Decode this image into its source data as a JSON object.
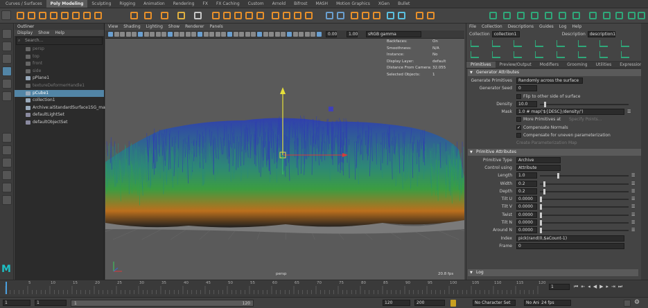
{
  "shelf_tabs": [
    "Curves / Surfaces",
    "Poly Modeling",
    "Sculpting",
    "Rigging",
    "Animation",
    "Rendering",
    "FX",
    "FX Caching",
    "Custom",
    "Arnold",
    "Bifrost",
    "MASH",
    "Motion Graphics",
    "XGen",
    "Bullet"
  ],
  "shelf_active": "Poly Modeling",
  "outliner": {
    "title": "Outliner",
    "menus": [
      "Display",
      "Show",
      "Help"
    ],
    "search_placeholder": "Search...",
    "items": [
      {
        "label": "persp",
        "dim": true
      },
      {
        "label": "top",
        "dim": true
      },
      {
        "label": "front",
        "dim": true
      },
      {
        "label": "side",
        "dim": true
      },
      {
        "label": "pPlane1",
        "dim": false
      },
      {
        "label": "textureDeformerHandle1",
        "dim": true
      },
      {
        "label": "pCube1",
        "dim": false,
        "selected": true
      },
      {
        "label": "collection1",
        "dim": false
      },
      {
        "label": "Archive:aiStandardSurface1SG_materi",
        "dim": false
      },
      {
        "label": "defaultLightSet",
        "dim": false
      },
      {
        "label": "defaultObjectSet",
        "dim": false
      }
    ]
  },
  "viewport": {
    "menus": [
      "View",
      "Shading",
      "Lighting",
      "Show",
      "Renderer",
      "Panels"
    ],
    "exposure": "0.00",
    "gamma": "1.00",
    "color_space": "sRGB gamma",
    "hud": [
      {
        "label": "Backfaces:",
        "value": "On"
      },
      {
        "label": "Smoothness:",
        "value": "N/A"
      },
      {
        "label": "Instance:",
        "value": "No"
      },
      {
        "label": "Display Layer:",
        "value": "default"
      },
      {
        "label": "Distance From Camera:",
        "value": "32.055"
      },
      {
        "label": "Selected Objects:",
        "value": "1"
      }
    ],
    "camera": "persp",
    "fps": "20.8 fps"
  },
  "xgen": {
    "menus": [
      "File",
      "Collection",
      "Descriptions",
      "Guides",
      "Log",
      "Help"
    ],
    "collection_label": "Collection",
    "collection_value": "collection1",
    "description_label": "Description",
    "description_value": "description1",
    "tabs": [
      "Primitives",
      "Preview/Output",
      "Modifiers",
      "Grooming",
      "Utilities",
      "Expressions"
    ],
    "active_tab": "Primitives",
    "generator": {
      "title": "Generator Attributes",
      "generate_primitives_label": "Generate Primitives",
      "generate_primitives_value": "Randomly across the surface",
      "seed_label": "Generator Seed",
      "seed_value": "0",
      "flip_label": "Flip to other side of surface",
      "density_label": "Density",
      "density_value": "10.0",
      "density_fraction": 0.05,
      "mask_label": "Mask",
      "mask_value": "1.0 # map('${DESC}/density/')",
      "more_primitives_label": "More Primitives at",
      "specify_points_label": "Specify Points...",
      "compensate_normals_label": "Compensate Normals",
      "compensate_normals_checked": true,
      "compensate_uneven_label": "Compensate for uneven parameterization",
      "create_map_label": "Create Parameterization Map"
    },
    "primitive": {
      "title": "Primitive Attributes",
      "type_label": "Primitive Type",
      "type_value": "Archive",
      "control_label": "Control using",
      "control_value": "Attribute",
      "attrs": [
        {
          "label": "Length",
          "value": "1.0",
          "fraction": 0.2
        },
        {
          "label": "Width",
          "value": "0.2",
          "fraction": 0.04
        },
        {
          "label": "Depth",
          "value": "0.2",
          "fraction": 0.04
        },
        {
          "label": "Tilt U",
          "value": "0.0000",
          "fraction": 0.0
        },
        {
          "label": "Tilt V",
          "value": "0.0000",
          "fraction": 0.0
        },
        {
          "label": "Twist",
          "value": "0.0000",
          "fraction": 0.0
        },
        {
          "label": "Tilt N",
          "value": "0.0000",
          "fraction": 0.0
        },
        {
          "label": "Around N",
          "value": "0.0000",
          "fraction": 0.0
        }
      ],
      "index_label": "Index",
      "index_value": "pick(rand(0,$aCount-1)",
      "frame_label": "Frame",
      "frame_value": "0"
    },
    "log_label": "Log"
  },
  "timeline": {
    "ticks": [
      "5",
      "10",
      "15",
      "20",
      "25",
      "30",
      "35",
      "40",
      "45",
      "50",
      "55",
      "60",
      "65",
      "70",
      "75",
      "80",
      "85",
      "90",
      "95",
      "100",
      "105",
      "110",
      "115",
      "120"
    ],
    "current_frame": "1"
  },
  "range": {
    "start": "1",
    "inner_start": "1",
    "slider_start": "1",
    "slider_end": "120",
    "inner_end": "120",
    "end": "200",
    "character_set": "No Character Set",
    "anim_layer": "No Anim Layer",
    "fps": "24 fps"
  },
  "colors": {
    "accent": "#5285a6",
    "shelf_orange": "#e8902a",
    "shelf_green": "#2fa87a",
    "grass_top": "#2f3fb0",
    "grass_mid": "#29a04e",
    "grass_bottom": "#c0701a"
  }
}
